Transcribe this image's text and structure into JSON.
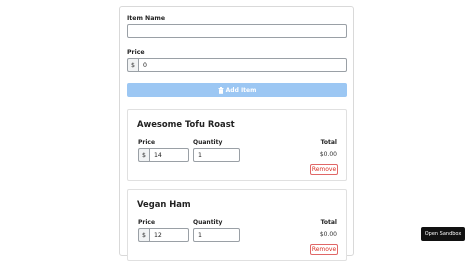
{
  "form": {
    "item_name_label": "Item Name",
    "item_name_value": "",
    "price_label": "Price",
    "price_prefix": "$",
    "price_value": "0",
    "add_button": "Add Item",
    "add_icon": "trash-icon"
  },
  "items": [
    {
      "name": "Awesome Tofu Roast",
      "price_label": "Price",
      "price_prefix": "$",
      "price": "14",
      "quantity_label": "Quantity",
      "quantity": "1",
      "total_label": "Total",
      "total": "$0.00",
      "remove_label": "Remove"
    },
    {
      "name": "Vegan Ham",
      "price_label": "Price",
      "price_prefix": "$",
      "price": "12",
      "quantity_label": "Quantity",
      "quantity": "1",
      "total_label": "Total",
      "total": "$0.00",
      "remove_label": "Remove"
    }
  ],
  "sandbox_button": "Open Sandbox",
  "colors": {
    "add_button_bg": "#9cc7f3",
    "remove": "#d93025",
    "sandbox_bg": "#111111"
  }
}
